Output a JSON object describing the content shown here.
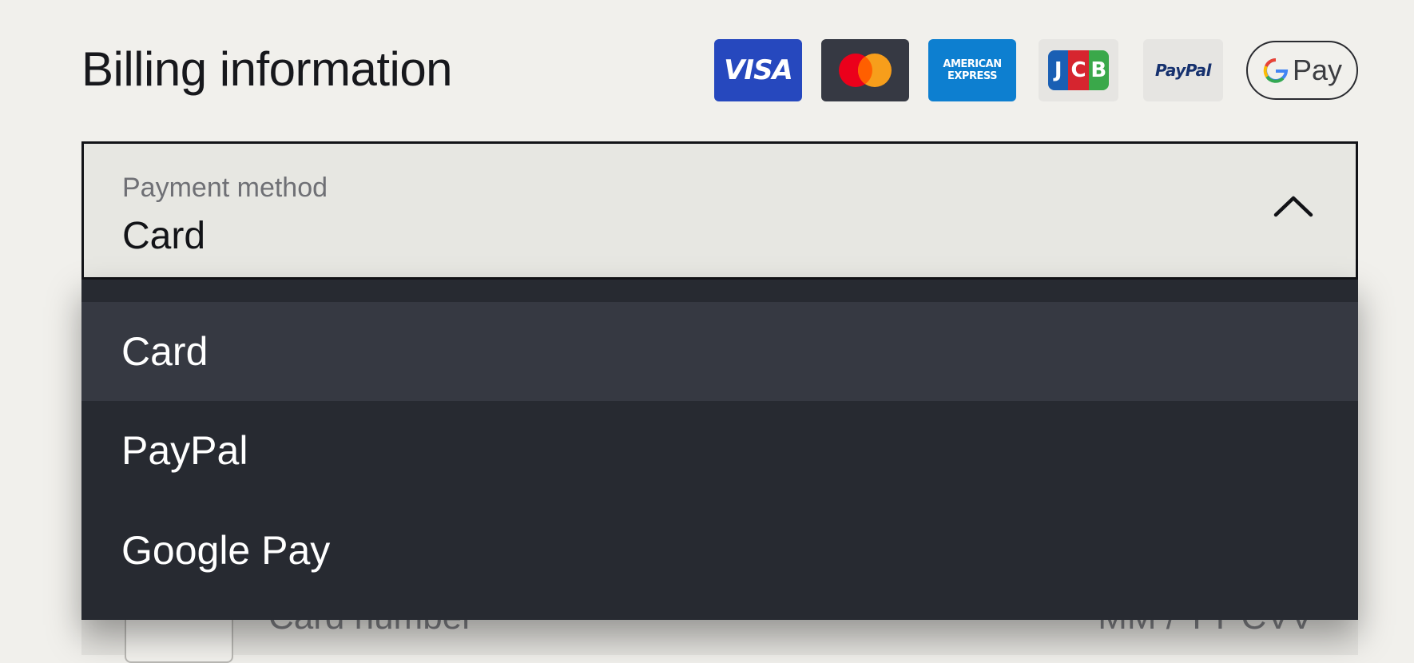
{
  "page": {
    "title": "Billing information"
  },
  "payment_logos": [
    {
      "name": "visa",
      "text": "VISA"
    },
    {
      "name": "mastercard",
      "text": ""
    },
    {
      "name": "american-express",
      "text": "AMERICAN EXPRESS"
    },
    {
      "name": "jcb",
      "text": "JCB"
    },
    {
      "name": "paypal",
      "text": "PayPal"
    },
    {
      "name": "google-pay",
      "text": "Pay"
    }
  ],
  "payment_method": {
    "label": "Payment method",
    "selected_value": "Card",
    "expanded": true
  },
  "dropdown": {
    "options": [
      {
        "label": "Card",
        "highlighted": true
      },
      {
        "label": "PayPal",
        "highlighted": false
      },
      {
        "label": "Google Pay",
        "highlighted": false
      }
    ]
  },
  "card_form": {
    "card_number_placeholder": "Card number",
    "expiry_cvv_placeholder": "MM / YY  CVV"
  },
  "colors": {
    "background": "#f1f0ec",
    "dropdown_bg": "#272a31",
    "dropdown_highlight": "#363942",
    "visa_blue": "#2648be",
    "amex_blue": "#0d7fd0"
  }
}
